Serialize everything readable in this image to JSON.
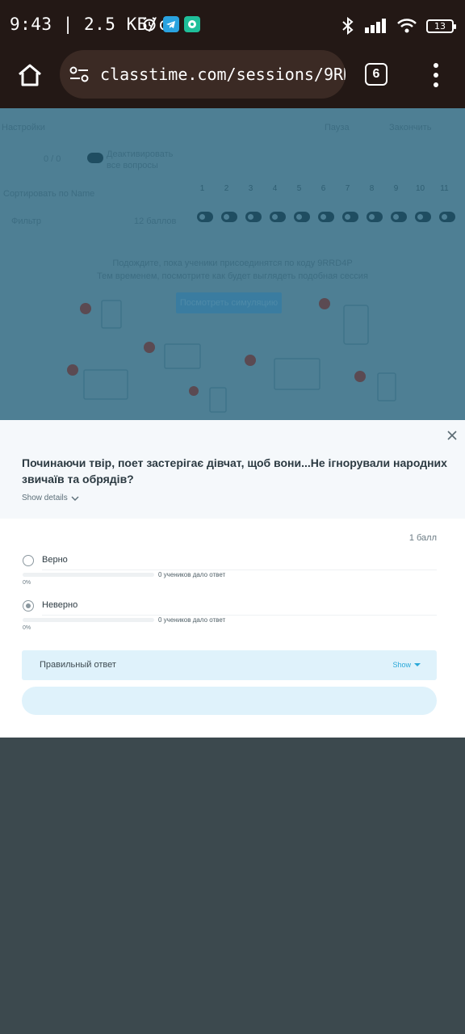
{
  "status_bar": {
    "time": "9:43 | 2.5 КБ/с",
    "battery": "13",
    "colors": {
      "telegram": "#2aa3e0",
      "app": "#1fbf9a"
    }
  },
  "browser": {
    "url": "classtime.com/sessions/9RRD'",
    "tab_count": "6"
  },
  "background_page": {
    "settings_link": "Настройки",
    "pause_label": "Пауза",
    "finish_label": "Закончить",
    "sort_label": "Сортировать по Name",
    "filter_label": "Фильтр",
    "score_label": "12 баллов",
    "score_short": "0 / 0",
    "deactivate_label": "Деактивировать все вопросы",
    "waiting_line1": "Подождите, пока ученики присоединятся по коду 9RRD4P",
    "waiting_line2": "Тем временем, посмотрите как будет выглядеть подобная сессия",
    "preview_button": "Посмотреть симуляцию",
    "question_numbers": [
      "1",
      "2",
      "3",
      "4",
      "5",
      "6",
      "7",
      "8",
      "9",
      "10",
      "11"
    ]
  },
  "dialog": {
    "question": "Починаючи твір, поет застерігає дівчат, щоб вони...Не ігнорували народних звичаїв та обрядів?",
    "show_details": "Show details",
    "points": "1 балл",
    "options": [
      {
        "label": "Верно",
        "selected": false,
        "count_text": "0 учеников дало ответ",
        "percent": "0%",
        "fill": 0
      },
      {
        "label": "Неверно",
        "selected": true,
        "count_text": "0 учеников дало ответ",
        "percent": "0%",
        "fill": 0
      }
    ],
    "correct_answer_label": "Правильный ответ",
    "show_label": "Show"
  }
}
